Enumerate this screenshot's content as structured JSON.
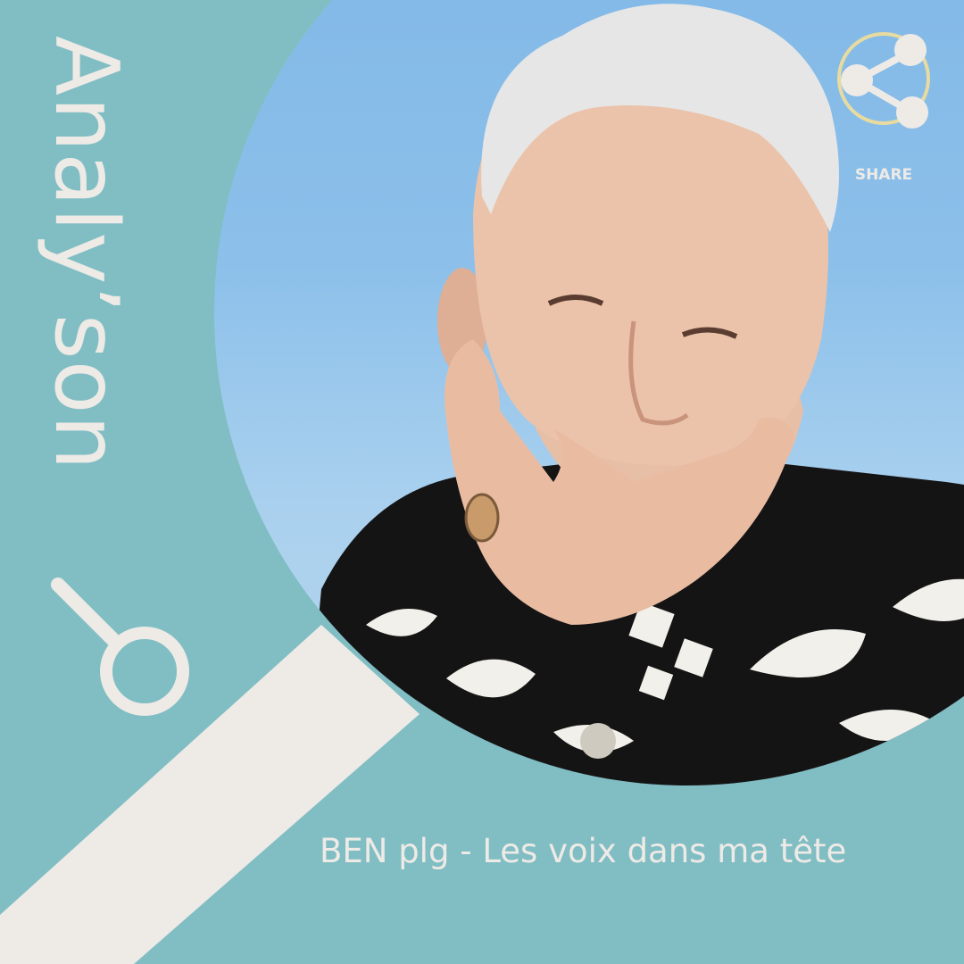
{
  "brand": {
    "title": "Analy’son"
  },
  "share": {
    "label": "SHARE",
    "icon": "share-icon"
  },
  "caption": "BEN plg - Les voix dans ma tête",
  "colors": {
    "background": "#80bec4",
    "cream": "#eeeae6",
    "sky": "#8cc0ea",
    "ring": "#e8dba0"
  }
}
